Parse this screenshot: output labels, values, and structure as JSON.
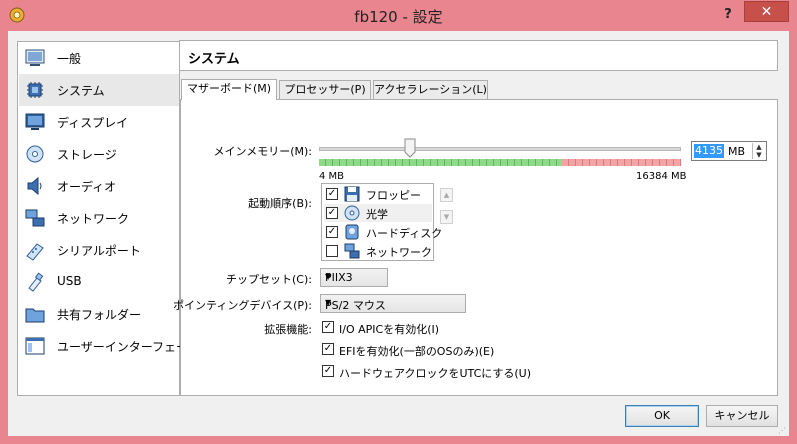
{
  "window": {
    "title": "fb120 - 設定",
    "help_label": "?",
    "close_label": "✕",
    "colors": {
      "frame": "#e9858f",
      "close": "#c7504a",
      "selection": "#3399ff"
    }
  },
  "sidebar": {
    "items": [
      {
        "label": "一般",
        "icon": "general-icon"
      },
      {
        "label": "システム",
        "icon": "system-icon",
        "selected": true
      },
      {
        "label": "ディスプレイ",
        "icon": "display-icon"
      },
      {
        "label": "ストレージ",
        "icon": "storage-icon"
      },
      {
        "label": "オーディオ",
        "icon": "audio-icon"
      },
      {
        "label": "ネットワーク",
        "icon": "network-icon"
      },
      {
        "label": "シリアルポート",
        "icon": "serial-port-icon"
      },
      {
        "label": "USB",
        "icon": "usb-icon"
      },
      {
        "label": "共有フォルダー",
        "icon": "shared-folder-icon"
      },
      {
        "label": "ユーザーインターフェース",
        "icon": "user-interface-icon"
      }
    ]
  },
  "header": {
    "title": "システム"
  },
  "tabs": [
    {
      "label": "マザーボード(M)",
      "active": true
    },
    {
      "label": "プロセッサー(P)"
    },
    {
      "label": "アクセラレーション(L)"
    }
  ],
  "motherboard": {
    "memory": {
      "label": "メインメモリー(M):",
      "value": "4135",
      "unit": "MB",
      "min_label": "4 MB",
      "max_label": "16384 MB",
      "min": 4,
      "max": 16384,
      "current": 4135,
      "safe_limit": 11000
    },
    "boot_order": {
      "label": "起動順序(B):",
      "items": [
        {
          "label": "フロッピー",
          "checked": true,
          "icon": "floppy-icon"
        },
        {
          "label": "光学",
          "checked": true,
          "icon": "optical-disc-icon"
        },
        {
          "label": "ハードディスク",
          "checked": true,
          "icon": "hard-disk-icon"
        },
        {
          "label": "ネットワーク",
          "checked": false,
          "icon": "network-boot-icon"
        }
      ],
      "up_symbol": "▲",
      "down_symbol": "▼"
    },
    "chipset": {
      "label": "チップセット(C):",
      "value": "PIIX3"
    },
    "pointing": {
      "label": "ポインティングデバイス(P):",
      "value": "PS/2 マウス"
    },
    "extended": {
      "label": "拡張機能:",
      "options": [
        {
          "label": "I/O APICを有効化(I)",
          "checked": true
        },
        {
          "label": "EFIを有効化(一部のOSのみ)(E)",
          "checked": true
        },
        {
          "label": "ハードウェアクロックをUTCにする(U)",
          "checked": true
        }
      ]
    }
  },
  "buttons": {
    "ok": "OK",
    "cancel": "キャンセル"
  },
  "symbols": {
    "check": "✓",
    "caret": "▼",
    "spin_up": "▲",
    "spin_down": "▼"
  }
}
